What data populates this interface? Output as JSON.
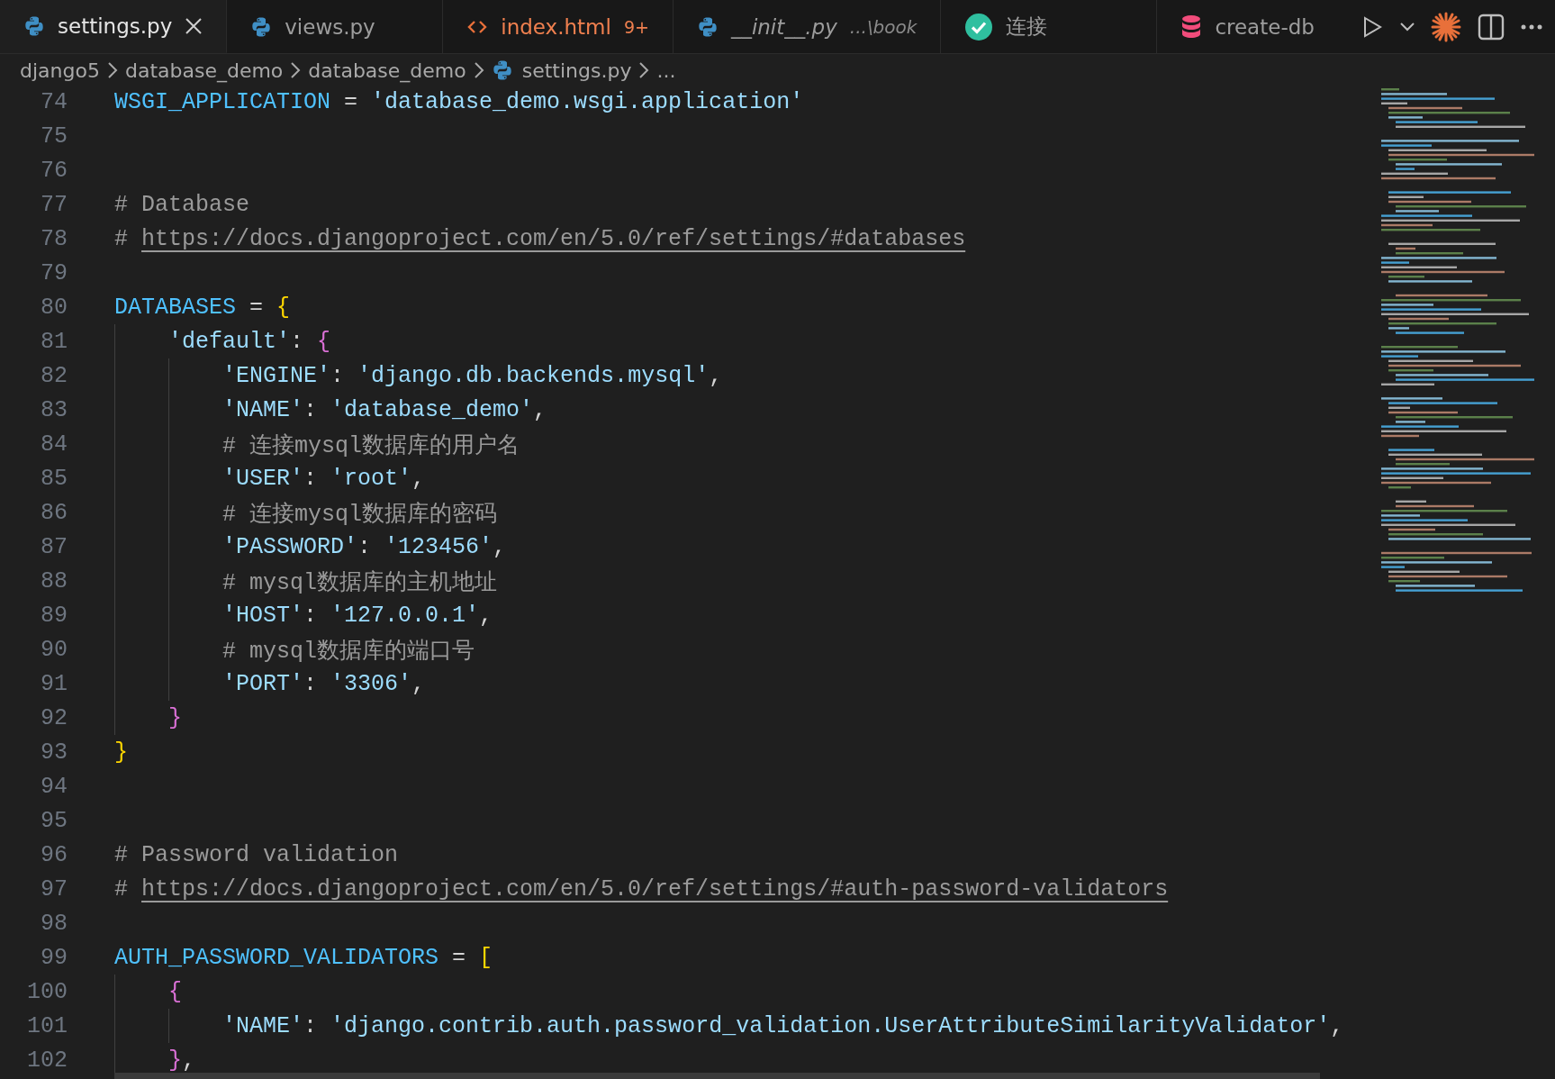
{
  "tabs": [
    {
      "label": "settings.py",
      "kind": "python",
      "selected": true,
      "preview": false,
      "has_errors": false
    },
    {
      "label": "views.py",
      "kind": "python",
      "selected": false,
      "preview": false,
      "has_errors": false
    },
    {
      "label": "index.html",
      "kind": "html",
      "selected": false,
      "preview": false,
      "has_errors": true,
      "badge": "9+"
    },
    {
      "label": "__init__.py",
      "kind": "python",
      "selected": false,
      "preview": true,
      "has_errors": false,
      "description": "...\\book"
    },
    {
      "label": "连接",
      "kind": "check",
      "selected": false,
      "preview": false,
      "has_errors": false
    },
    {
      "label": "create-db",
      "kind": "database",
      "selected": false,
      "preview": false,
      "has_errors": false
    }
  ],
  "breadcrumbs": [
    {
      "label": "django5",
      "kind": "folder"
    },
    {
      "label": "database_demo",
      "kind": "folder"
    },
    {
      "label": "database_demo",
      "kind": "folder"
    },
    {
      "label": "settings.py",
      "kind": "python"
    },
    {
      "label": "...",
      "kind": "more"
    }
  ],
  "lines": [
    {
      "number": "74",
      "tokens": [
        {
          "kind": "var",
          "text": "WSGI_APPLICATION"
        },
        {
          "kind": "op",
          "text": " = "
        },
        {
          "kind": "str",
          "text": "'database_demo.wsgi.application'"
        }
      ]
    },
    {
      "number": "75"
    },
    {
      "number": "76"
    },
    {
      "number": "77",
      "tokens": [
        {
          "kind": "comment",
          "text": "# Database"
        }
      ]
    },
    {
      "number": "78",
      "tokens": [
        {
          "kind": "comment",
          "text": "# "
        },
        {
          "kind": "link",
          "text": "https://docs.djangoproject.com/en/5.0/ref/settings/#databases"
        }
      ]
    },
    {
      "number": "79"
    },
    {
      "number": "80",
      "tokens": [
        {
          "kind": "var",
          "text": "DATABASES"
        },
        {
          "kind": "op",
          "text": " = "
        },
        {
          "kind": "bracket",
          "text": "{",
          "color": "#ffd700"
        }
      ]
    },
    {
      "number": "81",
      "tokens": [
        {
          "kind": "str",
          "text": "    'default'"
        },
        {
          "kind": "op",
          "text": ": "
        },
        {
          "kind": "bracket",
          "text": "{",
          "color": "#da70d6"
        }
      ]
    },
    {
      "number": "82",
      "tokens": [
        {
          "kind": "str",
          "text": "        'ENGINE'"
        },
        {
          "kind": "op",
          "text": ": "
        },
        {
          "kind": "str",
          "text": "'django.db.backends.mysql'"
        },
        {
          "kind": "op",
          "text": ","
        }
      ]
    },
    {
      "number": "83",
      "tokens": [
        {
          "kind": "str",
          "text": "        'NAME'"
        },
        {
          "kind": "op",
          "text": ": "
        },
        {
          "kind": "str",
          "text": "'database_demo'"
        },
        {
          "kind": "op",
          "text": ","
        }
      ]
    },
    {
      "number": "84",
      "tokens": [
        {
          "kind": "comment",
          "text": "        # 连接mysql数据库的用户名"
        }
      ]
    },
    {
      "number": "85",
      "tokens": [
        {
          "kind": "str",
          "text": "        'USER'"
        },
        {
          "kind": "op",
          "text": ": "
        },
        {
          "kind": "str",
          "text": "'root'"
        },
        {
          "kind": "op",
          "text": ","
        }
      ]
    },
    {
      "number": "86",
      "tokens": [
        {
          "kind": "comment",
          "text": "        # 连接mysql数据库的密码"
        }
      ]
    },
    {
      "number": "87",
      "tokens": [
        {
          "kind": "str",
          "text": "        'PASSWORD'"
        },
        {
          "kind": "op",
          "text": ": "
        },
        {
          "kind": "str",
          "text": "'123456'"
        },
        {
          "kind": "op",
          "text": ","
        }
      ]
    },
    {
      "number": "88",
      "tokens": [
        {
          "kind": "comment",
          "text": "        # mysql数据库的主机地址"
        }
      ]
    },
    {
      "number": "89",
      "tokens": [
        {
          "kind": "str",
          "text": "        'HOST'"
        },
        {
          "kind": "op",
          "text": ": "
        },
        {
          "kind": "str",
          "text": "'127.0.0.1'"
        },
        {
          "kind": "op",
          "text": ","
        }
      ]
    },
    {
      "number": "90",
      "tokens": [
        {
          "kind": "comment",
          "text": "        # mysql数据库的端口号"
        }
      ]
    },
    {
      "number": "91",
      "tokens": [
        {
          "kind": "str",
          "text": "        'PORT'"
        },
        {
          "kind": "op",
          "text": ": "
        },
        {
          "kind": "str",
          "text": "'3306'"
        },
        {
          "kind": "op",
          "text": ","
        }
      ]
    },
    {
      "number": "92",
      "tokens": [
        {
          "kind": "bracket",
          "text": "    }",
          "color": "#da70d6"
        }
      ]
    },
    {
      "number": "93",
      "tokens": [
        {
          "kind": "bracket",
          "text": "}",
          "color": "#ffd700"
        }
      ]
    },
    {
      "number": "94"
    },
    {
      "number": "95"
    },
    {
      "number": "96",
      "tokens": [
        {
          "kind": "comment",
          "text": "# Password validation"
        }
      ]
    },
    {
      "number": "97",
      "tokens": [
        {
          "kind": "comment",
          "text": "# "
        },
        {
          "kind": "link",
          "text": "https://docs.djangoproject.com/en/5.0/ref/settings/#auth-password-validators"
        }
      ]
    },
    {
      "number": "98"
    },
    {
      "number": "99",
      "tokens": [
        {
          "kind": "var",
          "text": "AUTH_PASSWORD_VALIDATORS"
        },
        {
          "kind": "op",
          "text": " = "
        },
        {
          "kind": "bracket",
          "text": "[",
          "color": "#ffd700"
        }
      ]
    },
    {
      "number": "100",
      "tokens": [
        {
          "kind": "bracket",
          "text": "    {",
          "color": "#da70d6"
        }
      ]
    },
    {
      "number": "101",
      "tokens": [
        {
          "kind": "str",
          "text": "        'NAME'"
        },
        {
          "kind": "op",
          "text": ": "
        },
        {
          "kind": "str",
          "text": "'django.contrib.auth.password_validation.UserAttributeSimilarityValidator'"
        },
        {
          "kind": "op",
          "text": ","
        }
      ]
    },
    {
      "number": "102",
      "tokens": [
        {
          "kind": "bracket",
          "text": "    }",
          "color": "#da70d6"
        },
        {
          "kind": "op",
          "text": ","
        }
      ]
    }
  ]
}
